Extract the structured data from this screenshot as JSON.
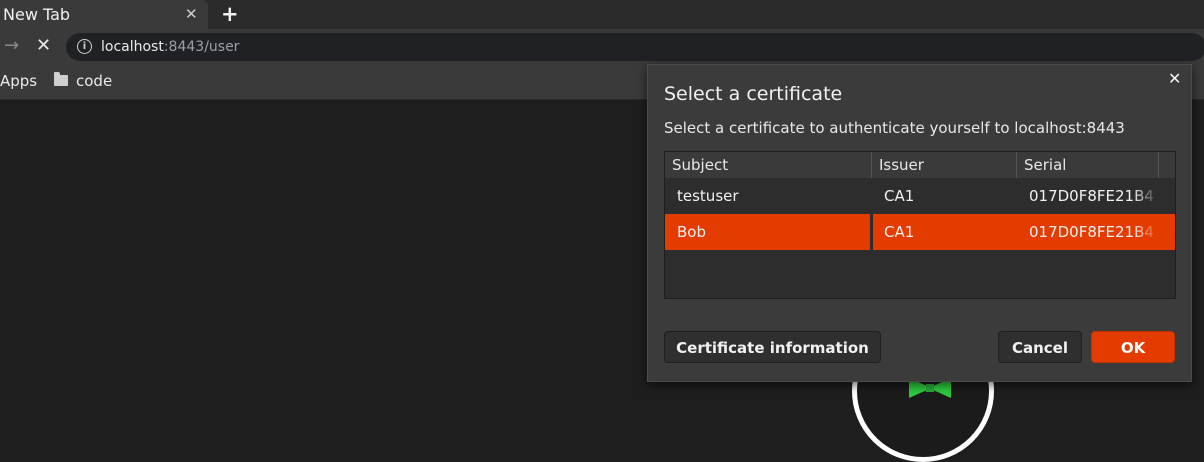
{
  "browser": {
    "tab_title": "New Tab",
    "tab_close": "✕",
    "new_tab": "+",
    "url_host": "localhost",
    "url_rest": ":8443/user",
    "bookmarks": [
      {
        "label": "Apps"
      },
      {
        "label": "code"
      }
    ]
  },
  "dialog": {
    "title": "Select a certificate",
    "subtitle": "Select a certificate to authenticate yourself to localhost:8443",
    "close": "✕",
    "columns": [
      "Subject",
      "Issuer",
      "Serial"
    ],
    "rows": [
      {
        "subject": "testuser",
        "issuer": "CA1",
        "serial": "017D0F8FE21B4",
        "selected": false
      },
      {
        "subject": "Bob",
        "issuer": "CA1",
        "serial": "017D0F8FE21B4",
        "selected": true
      }
    ],
    "buttons": {
      "info": "Certificate information",
      "cancel": "Cancel",
      "ok": "OK"
    },
    "accent_color": "#e33b00"
  }
}
